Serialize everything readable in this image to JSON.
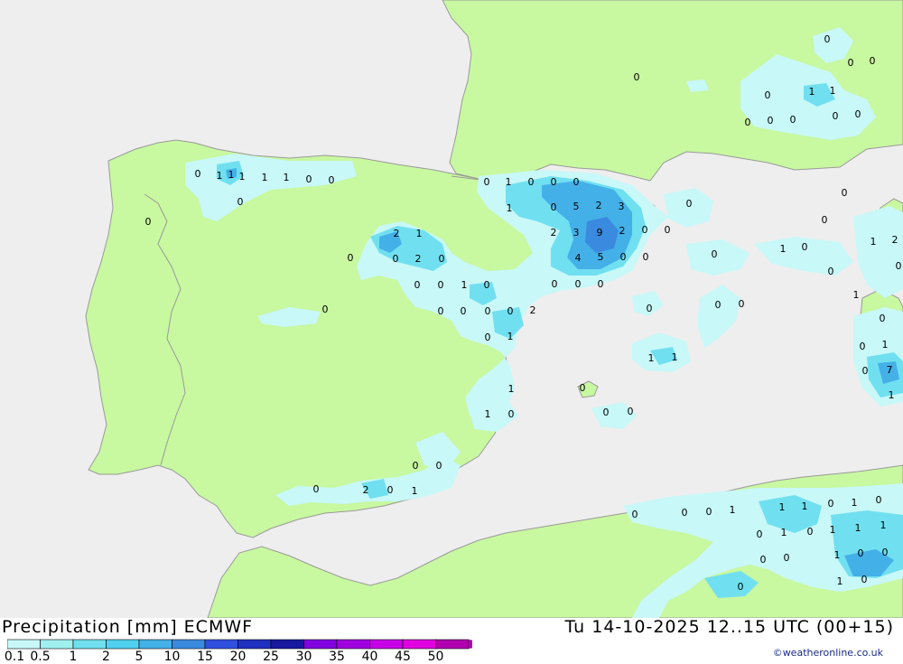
{
  "header": {
    "title": "Precipitation [mm] ECMWF",
    "valid_time": "Tu 14-10-2025 12..15 UTC (00+15)",
    "credit": "©weatheronline.co.uk"
  },
  "colors": {
    "sea": "#eeeeee",
    "land": "#c8f8a0",
    "border": "#9a9a9a",
    "precip_light": "#c8f8f8",
    "precip_mid": "#70e0f0",
    "precip_heavy": "#44b0e8",
    "precip_max": "#3a8ae0"
  },
  "legend": {
    "labels": [
      "0.1",
      "0.5",
      "1",
      "2",
      "5",
      "10",
      "15",
      "20",
      "25",
      "30",
      "35",
      "40",
      "45",
      "50"
    ],
    "colors": [
      "#c8f8f8",
      "#a0f0f0",
      "#70e0f0",
      "#50d0f0",
      "#44b0e8",
      "#3a8ae0",
      "#3050e0",
      "#2030c0",
      "#1818a0",
      "#8000e0",
      "#a000e0",
      "#c800e8",
      "#e000e0",
      "#b000b0"
    ]
  },
  "map_values": [
    {
      "v": "0"
    },
    {
      "v": "1"
    },
    {
      "v": "1"
    },
    {
      "v": "1"
    },
    {
      "v": "1"
    },
    {
      "v": "1"
    },
    {
      "v": "0"
    },
    {
      "v": "0"
    },
    {
      "v": "0"
    },
    {
      "v": "0"
    },
    {
      "v": "0"
    },
    {
      "v": "1"
    },
    {
      "v": "0"
    },
    {
      "v": "0"
    },
    {
      "v": "0"
    },
    {
      "v": "1"
    },
    {
      "v": "0"
    },
    {
      "v": "5"
    },
    {
      "v": "2"
    },
    {
      "v": "3"
    },
    {
      "v": "2"
    },
    {
      "v": "3"
    },
    {
      "v": "9"
    },
    {
      "v": "2"
    },
    {
      "v": "0"
    },
    {
      "v": "0"
    },
    {
      "v": "4"
    },
    {
      "v": "5"
    },
    {
      "v": "0"
    },
    {
      "v": "0"
    },
    {
      "v": "2"
    },
    {
      "v": "1"
    },
    {
      "v": "0"
    },
    {
      "v": "0"
    },
    {
      "v": "2"
    },
    {
      "v": "0"
    },
    {
      "v": "0"
    },
    {
      "v": "0"
    },
    {
      "v": "1"
    },
    {
      "v": "0"
    },
    {
      "v": "0"
    },
    {
      "v": "0"
    },
    {
      "v": "0"
    },
    {
      "v": "0"
    },
    {
      "v": "0"
    },
    {
      "v": "0"
    },
    {
      "v": "2"
    },
    {
      "v": "0"
    },
    {
      "v": "1"
    },
    {
      "v": "0"
    },
    {
      "v": "0"
    },
    {
      "v": "1"
    },
    {
      "v": "1"
    },
    {
      "v": "0"
    },
    {
      "v": "0"
    },
    {
      "v": "0"
    },
    {
      "v": "0"
    },
    {
      "v": "0"
    },
    {
      "v": "2"
    },
    {
      "v": "0"
    },
    {
      "v": "1"
    },
    {
      "v": "0"
    },
    {
      "v": "0"
    },
    {
      "v": "0"
    },
    {
      "v": "0"
    },
    {
      "v": "0"
    },
    {
      "v": "0"
    },
    {
      "v": "0"
    },
    {
      "v": "0"
    },
    {
      "v": "0"
    },
    {
      "v": "1"
    },
    {
      "v": "1"
    },
    {
      "v": "0"
    },
    {
      "v": "0"
    },
    {
      "v": "0"
    },
    {
      "v": "0"
    },
    {
      "v": "0"
    },
    {
      "v": "0"
    },
    {
      "v": "0"
    },
    {
      "v": "0"
    },
    {
      "v": "0"
    },
    {
      "v": "1"
    },
    {
      "v": "1"
    },
    {
      "v": "0"
    },
    {
      "v": "1"
    },
    {
      "v": "2"
    },
    {
      "v": "0"
    },
    {
      "v": "0"
    },
    {
      "v": "1"
    },
    {
      "v": "0"
    },
    {
      "v": "0"
    },
    {
      "v": "1"
    },
    {
      "v": "0"
    },
    {
      "v": "7"
    },
    {
      "v": "1"
    },
    {
      "v": "0"
    },
    {
      "v": "1"
    },
    {
      "v": "0"
    },
    {
      "v": "1"
    },
    {
      "v": "1"
    },
    {
      "v": "0"
    },
    {
      "v": "1"
    },
    {
      "v": "0"
    },
    {
      "v": "1"
    },
    {
      "v": "1"
    },
    {
      "v": "1"
    },
    {
      "v": "0"
    },
    {
      "v": "0"
    },
    {
      "v": "0"
    },
    {
      "v": "1"
    },
    {
      "v": "0"
    },
    {
      "v": "0"
    },
    {
      "v": "1"
    },
    {
      "v": "0"
    },
    {
      "v": "1"
    },
    {
      "v": "0"
    },
    {
      "v": "1"
    },
    {
      "v": "0"
    },
    {
      "v": "0"
    },
    {
      "v": "0"
    }
  ]
}
